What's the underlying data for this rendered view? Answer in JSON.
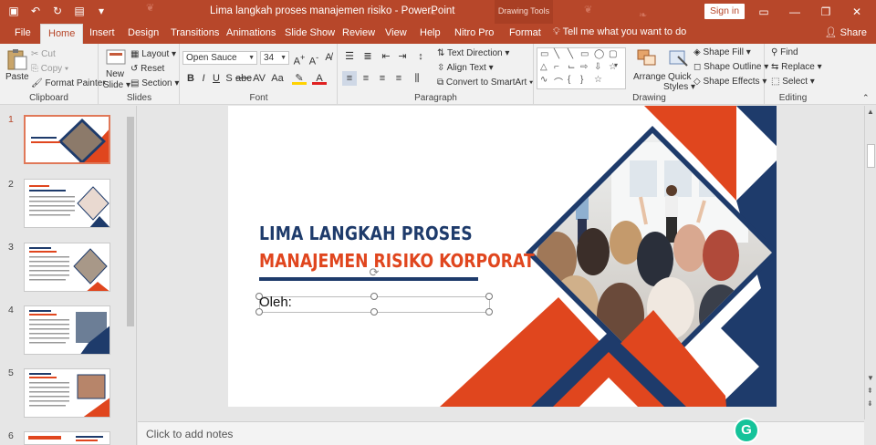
{
  "app": {
    "title": "Lima langkah proses manajemen risiko  -  PowerPoint",
    "contextual_tab": "Drawing Tools",
    "sign_in": "Sign in"
  },
  "tabs": {
    "items": [
      "File",
      "Home",
      "Insert",
      "Design",
      "Transitions",
      "Animations",
      "Slide Show",
      "Review",
      "View",
      "Help",
      "Nitro Pro",
      "Format"
    ],
    "active": "Home",
    "tell_me": "Tell me what you want to do",
    "share": "Share"
  },
  "ribbon": {
    "clipboard": {
      "paste": "Paste",
      "cut": "Cut",
      "copy": "Copy",
      "format_painter": "Format Painter",
      "label": "Clipboard"
    },
    "slides": {
      "new_slide": "New",
      "new_slide2": "Slide",
      "layout": "Layout",
      "reset": "Reset",
      "section": "Section",
      "label": "Slides"
    },
    "font": {
      "family": "Open Sauce",
      "size": "34",
      "label": "Font"
    },
    "paragraph": {
      "text_direction": "Text Direction",
      "align_text": "Align Text",
      "convert": "Convert to SmartArt",
      "label": "Paragraph"
    },
    "drawing": {
      "arrange": "Arrange",
      "quick_styles": "Quick",
      "quick_styles2": "Styles",
      "shape_fill": "Shape Fill",
      "shape_outline": "Shape Outline",
      "shape_effects": "Shape Effects",
      "label": "Drawing"
    },
    "editing": {
      "find": "Find",
      "replace": "Replace",
      "select": "Select",
      "label": "Editing"
    }
  },
  "thumbnails": {
    "numbers": [
      "1",
      "2",
      "3",
      "4",
      "5",
      "6"
    ],
    "active_index": 0
  },
  "slide": {
    "title_line1": "LIMA LANGKAH PROSES",
    "title_line2": "MANAJEMEN RISIKO KORPORAT",
    "subtitle": "Oleh:"
  },
  "notes": {
    "placeholder": "Click to add notes"
  },
  "colors": {
    "accent": "#b7472a",
    "navy": "#1e3b6b",
    "orange": "#e0461e"
  }
}
